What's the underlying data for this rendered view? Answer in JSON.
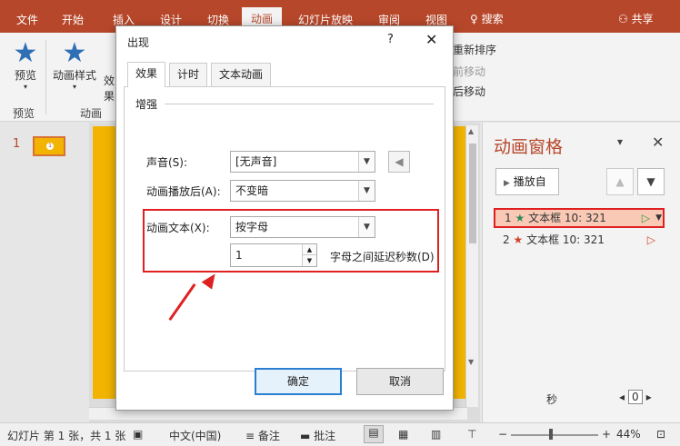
{
  "ribbon_tabs": [
    "文件",
    "开始",
    "插入",
    "设计",
    "切换",
    "动画",
    "幻灯片放映",
    "审阅",
    "视图"
  ],
  "active_tab": "动画",
  "tell_me": "搜索",
  "share": "共享",
  "ribbon": {
    "preview_btn": "预览",
    "preview_group": "预览",
    "anim_styles_btn": "动画样式",
    "effects_btn": "效果",
    "anim_group": "动画",
    "reorder_label": "重新排序",
    "move_earlier": "前移动",
    "move_later": "后移动"
  },
  "thumbnail": {
    "slide_number": "1",
    "dot": "1"
  },
  "anim_pane": {
    "title": "动画窗格",
    "play_from": "播放自",
    "items": [
      {
        "num": "1",
        "label": "文本框 10: 321",
        "selected": true
      },
      {
        "num": "2",
        "label": "文本框 10: 321",
        "selected": false
      }
    ],
    "seconds_label": "秒",
    "zoom_value": "0"
  },
  "status": {
    "slide_info": "幻灯片 第 1 张，共 1 张",
    "language": "中文(中国)",
    "notes": "备注",
    "comments": "批注",
    "zoom": "44%"
  },
  "dialog": {
    "title": "出现",
    "help": "?",
    "tabs": [
      "效果",
      "计时",
      "文本动画"
    ],
    "section": "增强",
    "sound_label": "声音(S):",
    "sound_value": "[无声音]",
    "after_label": "动画播放后(A):",
    "after_value": "不变暗",
    "text_label": "动画文本(X):",
    "text_value": "按字母",
    "delay_value": "1",
    "delay_label": "字母之间延迟秒数(D)",
    "ok": "确定",
    "cancel": "取消"
  },
  "colors": {
    "brand": "#b7472a",
    "highlight": "#e02020"
  }
}
